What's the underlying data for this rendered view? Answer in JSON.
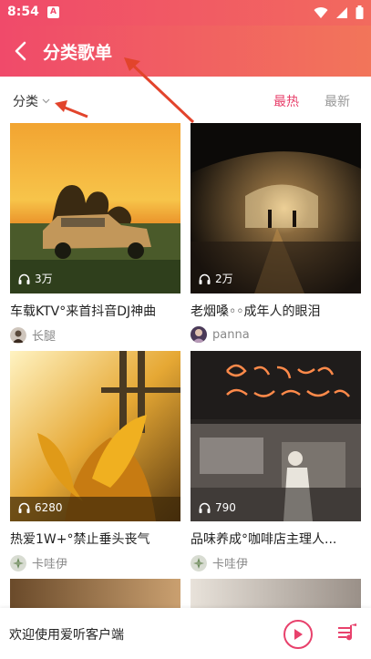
{
  "status": {
    "time": "8:54",
    "sim_label": "A"
  },
  "appbar": {
    "title": "分类歌单"
  },
  "filters": {
    "category": "分类",
    "hot": "最热",
    "newest": "最新"
  },
  "playlists": [
    {
      "title": "车载KTV°来首抖音DJ神曲",
      "plays": "3万",
      "author": "长腿"
    },
    {
      "title": "老烟嗓◦◦成年人的眼泪",
      "plays": "2万",
      "author": "panna"
    },
    {
      "title": "热爱1W+°禁止垂头丧气",
      "plays": "6280",
      "author": "卡哇伊"
    },
    {
      "title": "品味养成°咖啡店主理人...",
      "plays": "790",
      "author": "卡哇伊"
    }
  ],
  "player": {
    "message": "欢迎使用爱听客户端"
  },
  "colors": {
    "accent": "#e8416c",
    "header_start": "#f04a6a",
    "header_end": "#f2755a"
  }
}
